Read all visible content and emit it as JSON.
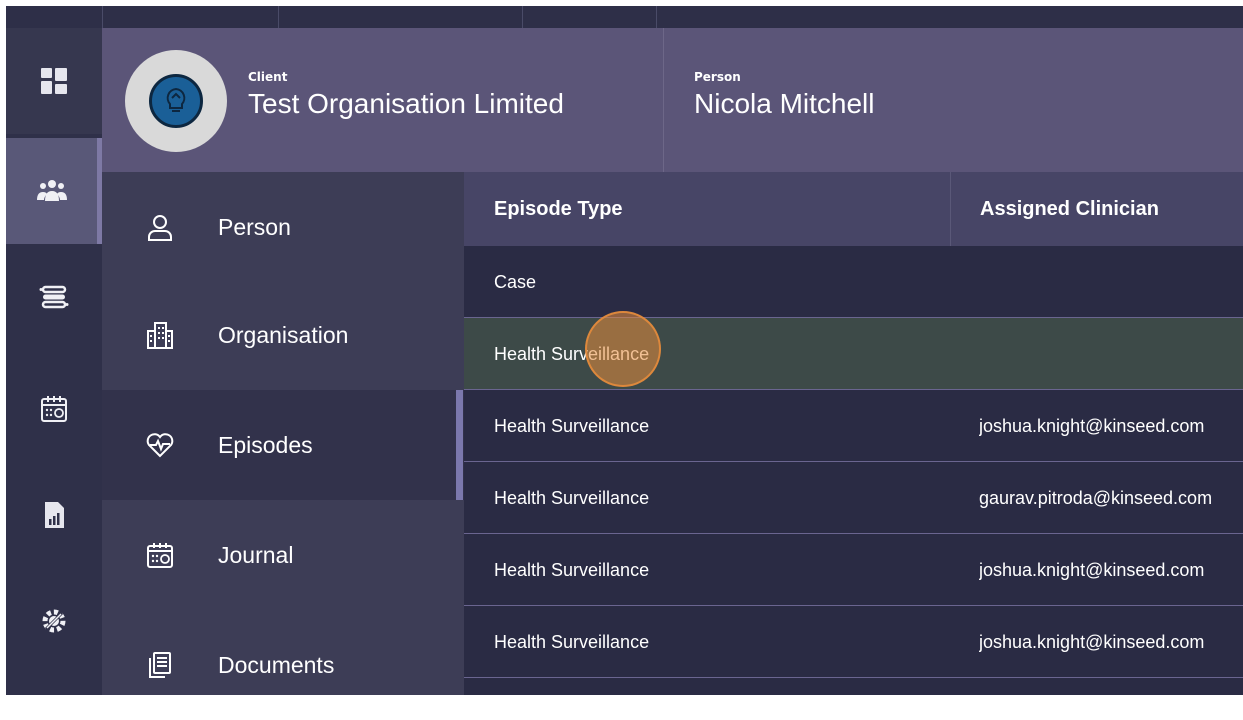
{
  "header": {
    "client_label": "Client",
    "client_name": "Test Organisation Limited",
    "person_label": "Person",
    "person_name": "Nicola Mitchell"
  },
  "rail": {
    "items": [
      {
        "icon": "dashboard-icon"
      },
      {
        "icon": "people-icon",
        "active": true
      },
      {
        "icon": "workflow-icon"
      },
      {
        "icon": "calendar-icon"
      },
      {
        "icon": "report-icon"
      },
      {
        "icon": "settings-icon"
      }
    ]
  },
  "subnav": {
    "items": [
      {
        "label": "Person",
        "icon": "person-icon"
      },
      {
        "label": "Organisation",
        "icon": "building-icon"
      },
      {
        "label": "Episodes",
        "icon": "heart-pulse-icon",
        "active": true
      },
      {
        "label": "Journal",
        "icon": "calendar-icon"
      },
      {
        "label": "Documents",
        "icon": "documents-icon"
      }
    ]
  },
  "table": {
    "headers": [
      "Episode Type",
      "Assigned Clinician"
    ],
    "rows": [
      {
        "type": "Case",
        "clinician": ""
      },
      {
        "type": "Health Surveillance",
        "clinician": ""
      },
      {
        "type": "Health Surveillance",
        "clinician": "joshua.knight@kinseed.com"
      },
      {
        "type": "Health Surveillance",
        "clinician": "gaurav.pitroda@kinseed.com"
      },
      {
        "type": "Health Surveillance",
        "clinician": "joshua.knight@kinseed.com"
      },
      {
        "type": "Health Surveillance",
        "clinician": "joshua.knight@kinseed.com"
      }
    ]
  },
  "colors": {
    "header_bg": "#5b5578",
    "rail_bg": "#2f3049",
    "table_bg": "#2a2b44",
    "accent": "#7b78ad"
  }
}
